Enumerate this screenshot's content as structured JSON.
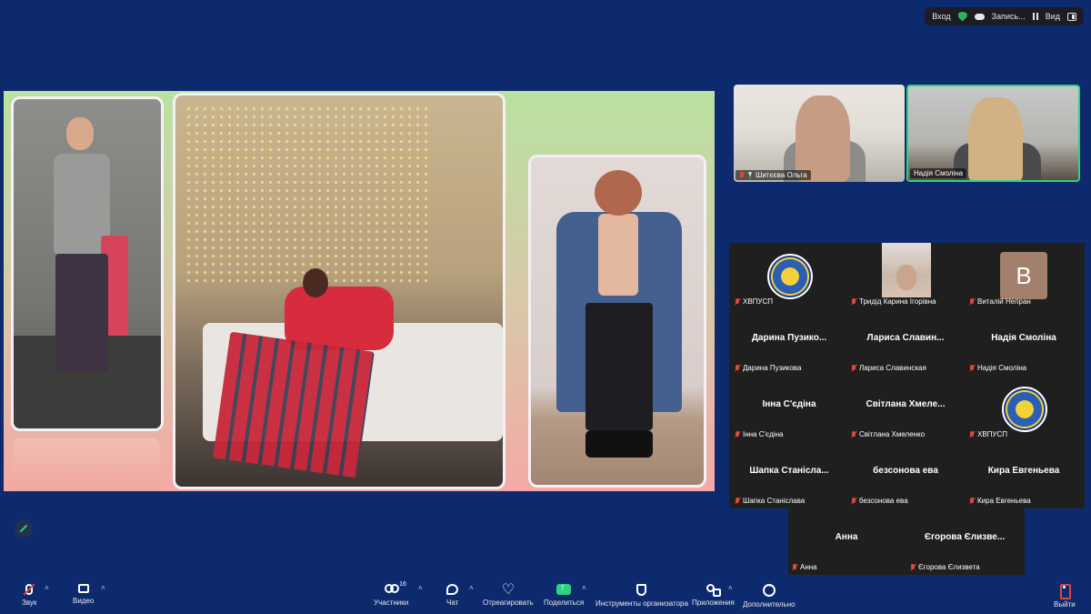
{
  "topbar": {
    "enter_label": "Вход",
    "record_label": "Запись...",
    "view_label": "Вид"
  },
  "videos": [
    {
      "name": "Шитєєва Ольга",
      "muted": true,
      "pinned": true
    },
    {
      "name": "Надія Смоліна",
      "muted": false,
      "active_speaker": true
    }
  ],
  "gallery": [
    {
      "display": "",
      "label": "ХВПУСП",
      "avatar": "logo"
    },
    {
      "display": "",
      "label": "Тридід Карина Ігорівна",
      "avatar": "photo"
    },
    {
      "display": "В",
      "label": "Виталій Непран",
      "avatar": "letter"
    },
    {
      "display": "Дарина  Пузико...",
      "label": "Дарина Пузикова"
    },
    {
      "display": "Лариса  Славин...",
      "label": "Лариса Славинская"
    },
    {
      "display": "Надія Смоліна",
      "label": "Надія Смоліна"
    },
    {
      "display": "Інна С'єдіна",
      "label": "Інна С'єдіна"
    },
    {
      "display": "Світлана  Хмеле...",
      "label": "Світлана Хмеленко"
    },
    {
      "display": "",
      "label": "ХВПУСП",
      "avatar": "logo"
    },
    {
      "display": "Шапка  Станісла...",
      "label": "Шапка Станіслава"
    },
    {
      "display": "безсонова ева",
      "label": "безсонова ева"
    },
    {
      "display": "Кира Евгеньева",
      "label": "Кира Евгеньева"
    },
    {
      "display": "Анна",
      "label": "Анна"
    },
    {
      "display": "Єгорова  Єлизве...",
      "label": "Єгорова Єлизвета"
    }
  ],
  "toolbar": {
    "audio": "Звук",
    "video": "Видео",
    "participants": "Участники",
    "participants_count": "16",
    "chat": "Чат",
    "react": "Отреагировать",
    "share": "Поделиться",
    "host_tools": "Инструменты организатора",
    "apps": "Приложения",
    "more": "Дополнительно",
    "leave": "Выйти"
  },
  "icons": [
    "mic-muted-icon",
    "camera-icon",
    "participants-icon",
    "chat-icon",
    "heart-icon",
    "share-screen-icon",
    "shield-icon",
    "apps-icon",
    "more-icon",
    "leave-icon",
    "pencil-icon",
    "shield-check-icon",
    "cloud-icon",
    "pause-icon",
    "view-icon"
  ],
  "colors": {
    "background": "#0d2a6e",
    "accent": "#2bd47e",
    "muted": "#e0463b"
  }
}
